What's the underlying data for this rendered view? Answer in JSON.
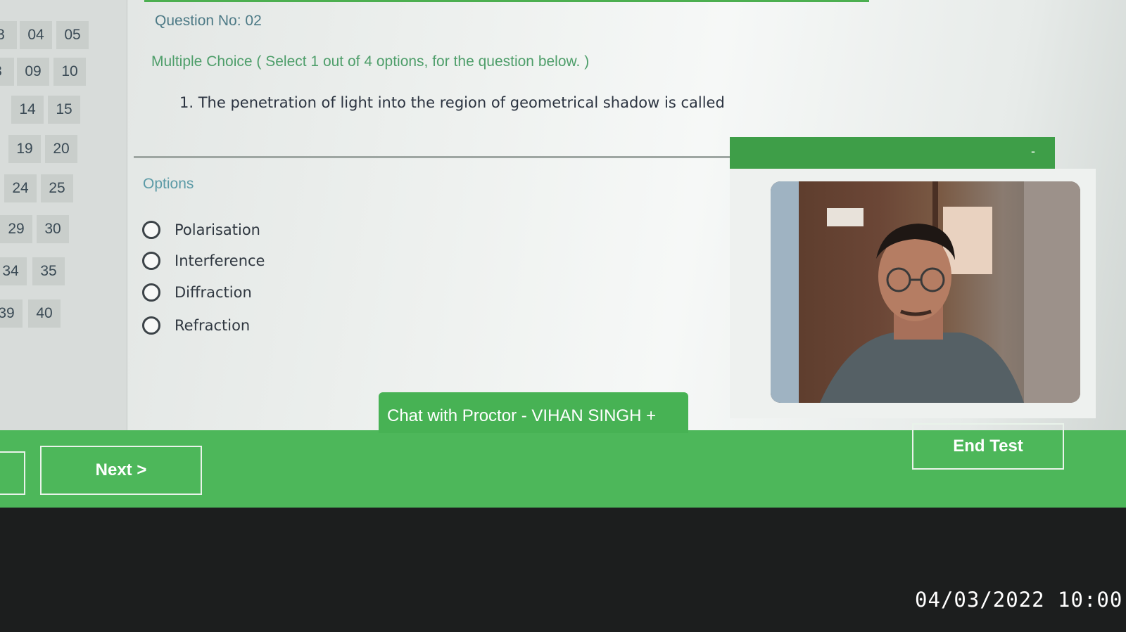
{
  "palette": {
    "rows": [
      [
        "3",
        "04",
        "05"
      ],
      [
        "3",
        "09",
        "10"
      ],
      [
        "14",
        "15"
      ],
      [
        "19",
        "20"
      ],
      [
        "24",
        "25"
      ],
      [
        "29",
        "30"
      ],
      [
        "34",
        "35"
      ],
      [
        "39",
        "40"
      ]
    ]
  },
  "question": {
    "number_label": "Question No: 02",
    "type_label": "Multiple Choice ( Select 1 out of 4 options, for the question below. )",
    "text": "1. The penetration of light into the region of geometrical shadow is called",
    "options_label": "Options",
    "options": [
      "Polarisation",
      "Interference",
      "Diffraction",
      "Refraction"
    ]
  },
  "proctor": {
    "minimize_label": "-",
    "chat_label": "Chat with Proctor - VIHAN SINGH  +"
  },
  "footer": {
    "next_label": "Next >",
    "end_label": "End Test"
  },
  "photo": {
    "timestamp": "04/03/2022 10:00"
  },
  "colors": {
    "accent_green": "#4db75a",
    "header_green": "#3e9e48"
  },
  "icons": [
    "radio-circle-icon",
    "minimize-icon",
    "plus-icon"
  ]
}
